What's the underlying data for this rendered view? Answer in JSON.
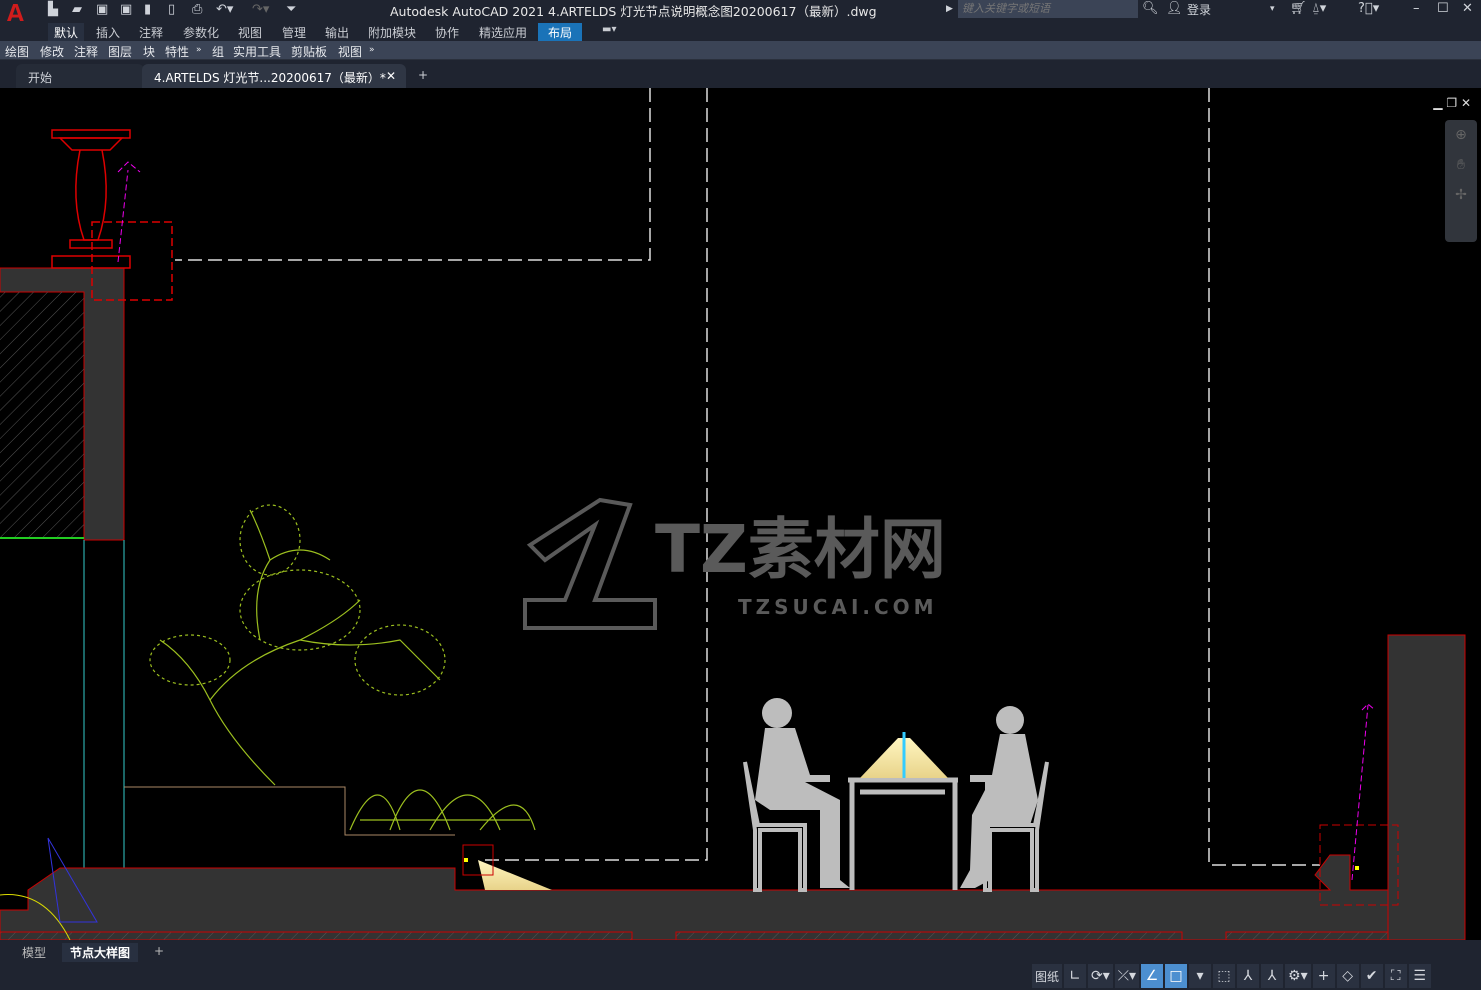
{
  "app": {
    "logo": "A",
    "title": "Autodesk AutoCAD 2021    4.ARTELDS 灯光节点说明概念图20200617（最新）.dwg"
  },
  "search": {
    "placeholder": "键入关键字或短语"
  },
  "user": {
    "login": "登录"
  },
  "ribbon_tabs": [
    "默认",
    "插入",
    "注释",
    "参数化",
    "视图",
    "管理",
    "输出",
    "附加模块",
    "协作",
    "精选应用",
    "布局"
  ],
  "panels": [
    "绘图",
    "修改",
    "注释",
    "图层",
    "块",
    "特性",
    "组",
    "实用工具",
    "剪贴板",
    "视图"
  ],
  "file_tabs": {
    "start": "开始",
    "active": "4.ARTELDS 灯光节...20200617（最新）*",
    "add": "+"
  },
  "layout_tabs": {
    "model": "模型",
    "active": "节点大样图",
    "add": "+"
  },
  "status": {
    "paper": "图纸"
  },
  "watermark": {
    "main": "TZ素材网",
    "sub": "TZSUCAI.COM"
  },
  "colors": {
    "accent": "#1a73b8",
    "wall": "#333333",
    "outline": "#c00000",
    "plant": "#9cbf1f",
    "person": "#bdbdbd"
  }
}
